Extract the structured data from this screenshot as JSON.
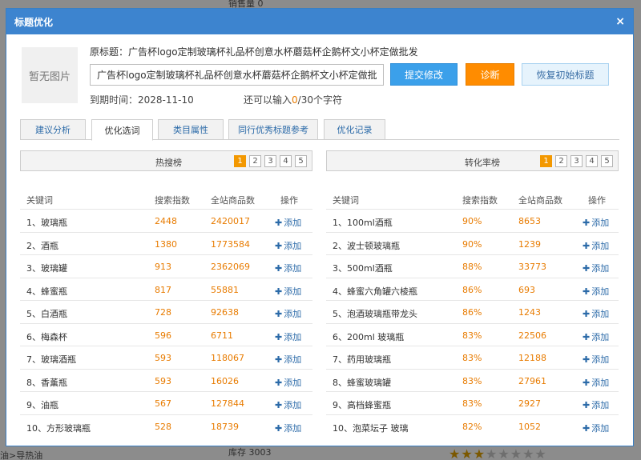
{
  "background": {
    "top_sales": "销售量 0",
    "bottom_stock": "库存 3003",
    "bottom_left": "油>导热油",
    "stars_on": 3,
    "stars_total": 8
  },
  "dialog": {
    "title": "标题优化",
    "close_icon": "×"
  },
  "product": {
    "thumb_text": "暂无图片",
    "original_title": "原标题：广告杯logo定制玻璃杯礼品杯创意水杯蘑菇杯企鹅杯文小杯定做批发",
    "input_value": "广告杯logo定制玻璃杯礼品杯创意水杯蘑菇杯企鹅杯文小杯定做批发",
    "expire": "到期时间：2028-11-10",
    "remain_prefix": "还可以输入",
    "remain_count": "0",
    "remain_suffix": "/30个字符"
  },
  "buttons": {
    "submit": "提交修改",
    "diagnose": "诊断",
    "restore": "恢复初始标题"
  },
  "tabs": [
    "建议分析",
    "优化选词",
    "类目属性",
    "同行优秀标题参考",
    "优化记录"
  ],
  "active_tab": 1,
  "hot_panel": {
    "title": "热搜榜",
    "pages": [
      "1",
      "2",
      "3",
      "4",
      "5"
    ],
    "headers": [
      "关键词",
      "搜索指数",
      "全站商品数",
      "操作"
    ],
    "rows": [
      {
        "kw": "1、玻璃瓶",
        "search": "2448",
        "goods": "2420017",
        "action": "添加"
      },
      {
        "kw": "2、酒瓶",
        "search": "1380",
        "goods": "1773584",
        "action": "添加"
      },
      {
        "kw": "3、玻璃罐",
        "search": "913",
        "goods": "2362069",
        "action": "添加"
      },
      {
        "kw": "4、蜂蜜瓶",
        "search": "817",
        "goods": "55881",
        "action": "添加"
      },
      {
        "kw": "5、白酒瓶",
        "search": "728",
        "goods": "92638",
        "action": "添加"
      },
      {
        "kw": "6、梅森杯",
        "search": "596",
        "goods": "6711",
        "action": "添加"
      },
      {
        "kw": "7、玻璃酒瓶",
        "search": "593",
        "goods": "118067",
        "action": "添加"
      },
      {
        "kw": "8、香薰瓶",
        "search": "593",
        "goods": "16026",
        "action": "添加"
      },
      {
        "kw": "9、油瓶",
        "search": "567",
        "goods": "127844",
        "action": "添加"
      },
      {
        "kw": "10、方形玻璃瓶",
        "search": "528",
        "goods": "18739",
        "action": "添加"
      }
    ]
  },
  "conv_panel": {
    "title": "转化率榜",
    "pages": [
      "1",
      "2",
      "3",
      "4",
      "5"
    ],
    "headers": [
      "关键词",
      "搜索指数",
      "全站商品数",
      "操作"
    ],
    "rows": [
      {
        "kw": "1、100ml酒瓶",
        "search": "90%",
        "goods": "8653",
        "action": "添加"
      },
      {
        "kw": "2、波士顿玻璃瓶",
        "search": "90%",
        "goods": "1239",
        "action": "添加"
      },
      {
        "kw": "3、500ml酒瓶",
        "search": "88%",
        "goods": "33773",
        "action": "添加"
      },
      {
        "kw": "4、蜂蜜六角罐六棱瓶",
        "search": "86%",
        "goods": "693",
        "action": "添加"
      },
      {
        "kw": "5、泡酒玻璃瓶带龙头",
        "search": "86%",
        "goods": "1243",
        "action": "添加"
      },
      {
        "kw": "6、200ml 玻璃瓶",
        "search": "83%",
        "goods": "22506",
        "action": "添加"
      },
      {
        "kw": "7、药用玻璃瓶",
        "search": "83%",
        "goods": "12188",
        "action": "添加"
      },
      {
        "kw": "8、蜂蜜玻璃罐",
        "search": "83%",
        "goods": "27961",
        "action": "添加"
      },
      {
        "kw": "9、高档蜂蜜瓶",
        "search": "83%",
        "goods": "2927",
        "action": "添加"
      },
      {
        "kw": "10、泡菜坛子 玻璃",
        "search": "82%",
        "goods": "1052",
        "action": "添加"
      }
    ]
  },
  "colors": {
    "header_blue": "#3d84cf",
    "accent_orange": "#e87b00",
    "link_blue": "#2b6aa8"
  }
}
